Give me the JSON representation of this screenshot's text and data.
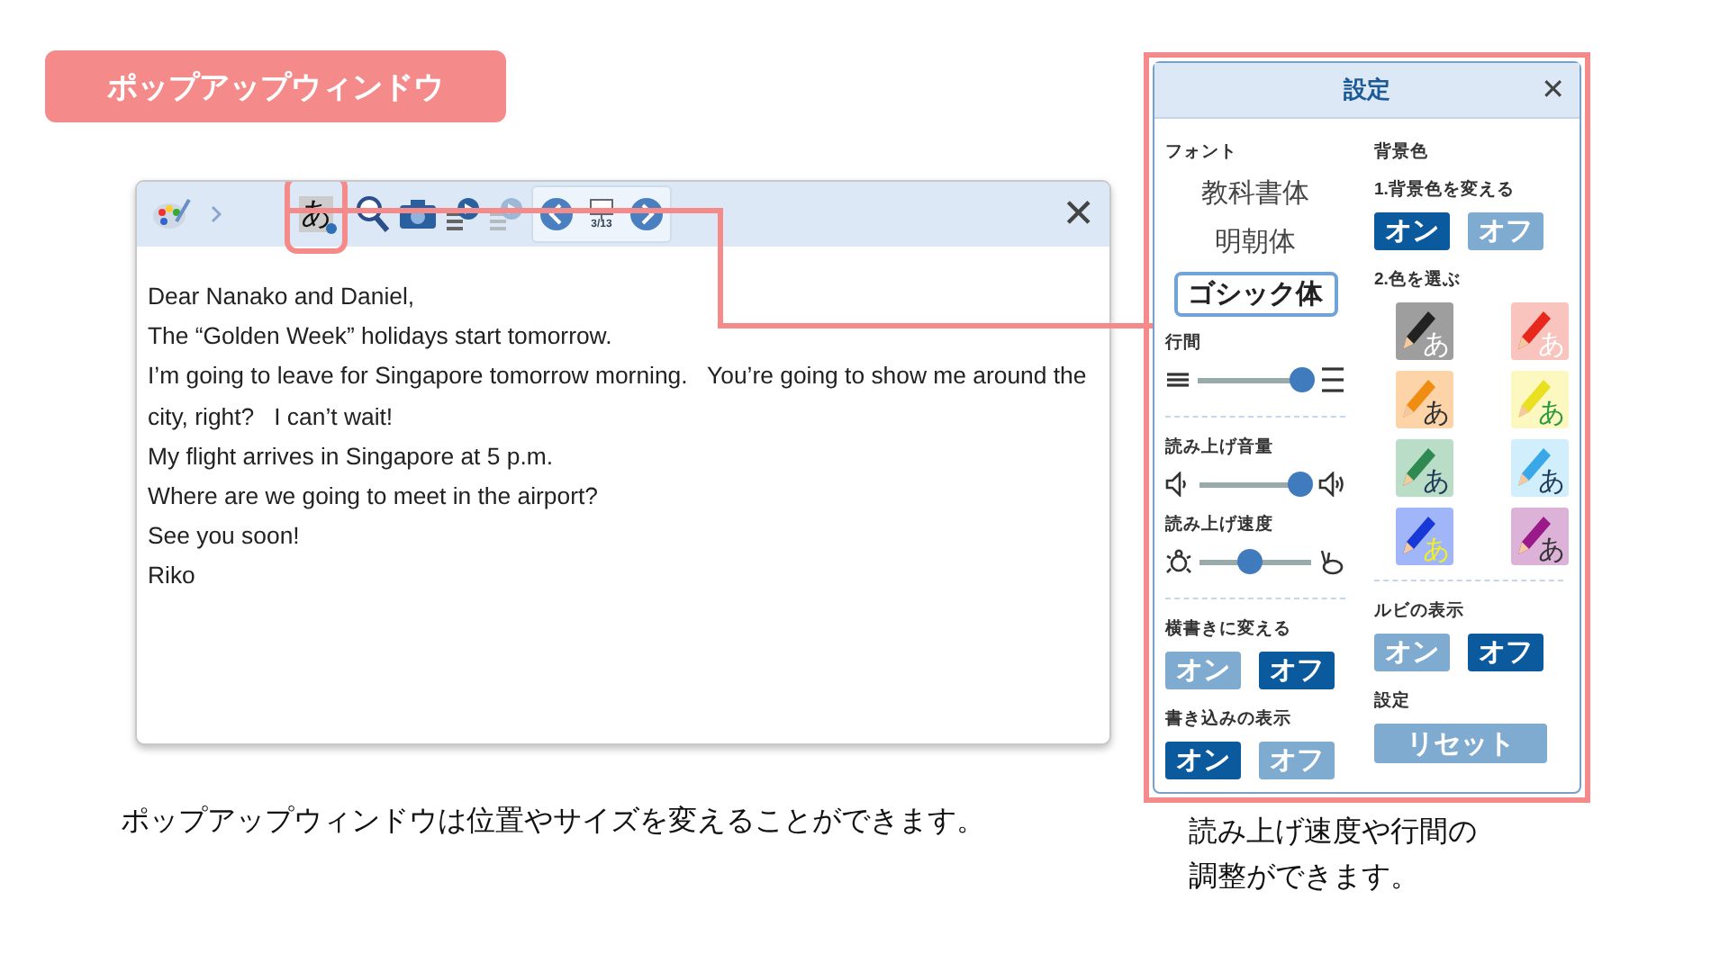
{
  "title_badge": "ポップアップウィンドウ",
  "popup": {
    "toolbar": [
      {
        "kind": "palette"
      },
      {
        "kind": "chevron"
      },
      {
        "kind": "font-settings",
        "label": "あ",
        "highlighted": true
      },
      {
        "kind": "zoom"
      },
      {
        "kind": "camera"
      },
      {
        "kind": "read",
        "disabled": false
      },
      {
        "kind": "read",
        "disabled": true
      },
      {
        "kind": "pager",
        "page": "3/13"
      }
    ],
    "close": "✕",
    "lines": [
      "Dear Nanako and Daniel,",
      "The “Golden Week” holidays start tomorrow.",
      "I’m going to leave for Singapore tomorrow morning.   You’re going to show me around the",
      "city, right?   I can’t wait!",
      "My flight arrives in Singapore at 5 p.m.",
      "Where are we going to meet in the airport?",
      "See you soon!",
      "Riko"
    ]
  },
  "caption_left": "ポップアップウィンドウは位置やサイズを変えることができます。",
  "settings": {
    "title": "設定",
    "close": "✕",
    "left": [
      {
        "kind": "fonts",
        "label": "フォント",
        "options": [
          {
            "label": "教科書体",
            "selected": false
          },
          {
            "label": "明朝体",
            "selected": false
          },
          {
            "label": "ゴシック体",
            "selected": true
          }
        ]
      },
      {
        "kind": "spacing-slider",
        "label": "行間",
        "level": 0.9
      },
      {
        "kind": "divider"
      },
      {
        "kind": "volume-slider",
        "label": "読み上げ音量",
        "level": 0.9
      },
      {
        "kind": "speed-slider",
        "label": "読み上げ速度",
        "level": 0.45
      },
      {
        "kind": "divider"
      },
      {
        "kind": "toggle",
        "label": "横書きに変える",
        "options": [
          {
            "label": "オン",
            "selected": false
          },
          {
            "label": "オフ",
            "selected": true
          }
        ]
      },
      {
        "kind": "toggle",
        "label": "書き込みの表示",
        "options": [
          {
            "label": "オン",
            "selected": true
          },
          {
            "label": "オフ",
            "selected": false
          }
        ]
      }
    ],
    "right": [
      {
        "kind": "heading",
        "label": "背景色"
      },
      {
        "kind": "toggle",
        "label": "1.背景色を変える",
        "options": [
          {
            "label": "オン",
            "selected": true
          },
          {
            "label": "オフ",
            "selected": false
          }
        ]
      },
      {
        "kind": "swatches",
        "label": "2.色を選ぶ",
        "swatches": [
          {
            "glyph": "あ",
            "color": "#9e9e9e"
          },
          {
            "glyph": "あ",
            "color": "#f9c4be"
          },
          {
            "glyph": "あ",
            "color": "#fcd4a8"
          },
          {
            "glyph": "あ",
            "color": "#fdf8c0"
          },
          {
            "glyph": "あ",
            "color": "#b9ddc6"
          },
          {
            "glyph": "あ",
            "color": "#d0eefc"
          },
          {
            "glyph": "あ",
            "color": "#a0b6f8"
          },
          {
            "glyph": "あ",
            "color": "#ddb2d9"
          }
        ]
      },
      {
        "kind": "divider"
      },
      {
        "kind": "toggle",
        "label": "ルビの表示",
        "options": [
          {
            "label": "オン",
            "selected": false
          },
          {
            "label": "オフ",
            "selected": true
          }
        ]
      },
      {
        "kind": "button",
        "label": "設定",
        "button": "リセット"
      }
    ]
  },
  "caption_right": [
    "読み上げ速度や行間の",
    "調整ができます。"
  ]
}
